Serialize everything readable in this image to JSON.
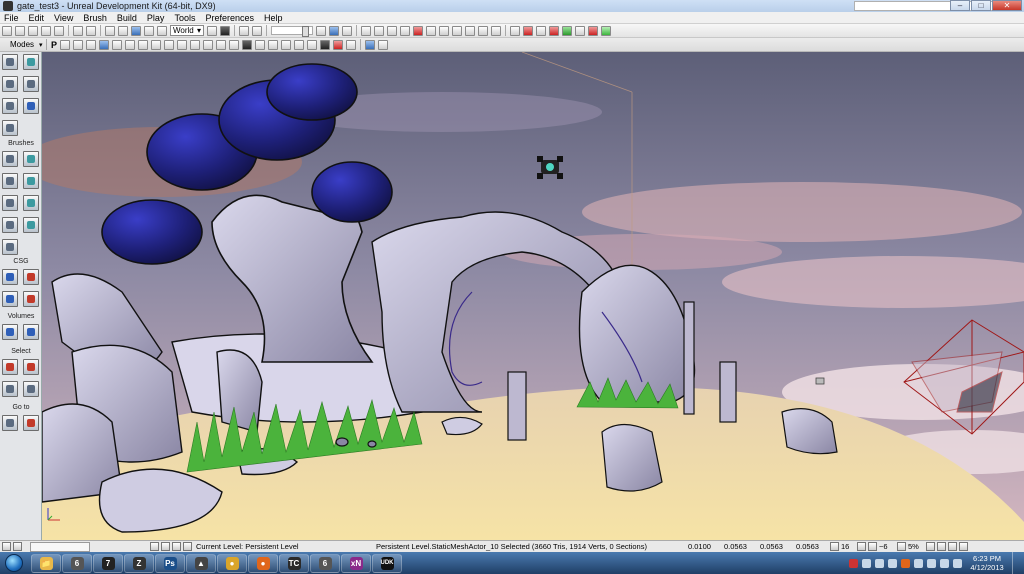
{
  "window": {
    "title": "gate_test3 - Unreal Development Kit (64-bit, DX9)",
    "minimize_glyph": "–",
    "maximize_glyph": "□",
    "close_glyph": "✕"
  },
  "menu": [
    "File",
    "Edit",
    "View",
    "Brush",
    "Build",
    "Play",
    "Tools",
    "Preferences",
    "Help"
  ],
  "toolbar": {
    "coordinate_system": "World",
    "coordinate_system_arrow": "▾"
  },
  "modes_panel": {
    "header": "Modes",
    "sections": {
      "brushes": "Brushes",
      "csg": "CSG",
      "volumes": "Volumes",
      "select": "Select",
      "goto": "Go to"
    }
  },
  "viewport_toolbar": {
    "perspective_label": "P"
  },
  "status_bar": {
    "current_level": "Current Level: Persistent Level",
    "selection": "Persistent Level.StaticMeshActor_10 Selected (3660 Tris, 1914 Verts, 0 Sections)",
    "drag_grid_values": [
      "0.0100",
      "0.0563",
      "0.0563",
      "0.0563"
    ],
    "grid_size": "16",
    "rotation_snap": "~6",
    "scale_snap": "5%"
  },
  "taskbar": {
    "apps": [
      {
        "name": "windows-explorer",
        "glyph": "📁",
        "color": "#e8b84a"
      },
      {
        "name": "app-6",
        "glyph": "6",
        "color": "#555555"
      },
      {
        "name": "app-7",
        "glyph": "7",
        "color": "#222222"
      },
      {
        "name": "zbrush",
        "glyph": "Z",
        "color": "#333333"
      },
      {
        "name": "photoshop",
        "glyph": "Ps",
        "color": "#1b4f8a"
      },
      {
        "name": "app-car",
        "glyph": "▲",
        "color": "#444444"
      },
      {
        "name": "chrome",
        "glyph": "●",
        "color": "#d9a52a"
      },
      {
        "name": "firefox",
        "glyph": "●",
        "color": "#e0661b"
      },
      {
        "name": "app-tc",
        "glyph": "TC",
        "color": "#2a2a2a"
      },
      {
        "name": "app-6b",
        "glyph": "6",
        "color": "#555555"
      },
      {
        "name": "xnormal",
        "glyph": "xN",
        "color": "#8a2a8a"
      },
      {
        "name": "udk",
        "glyph": "UDK",
        "color": "#111111"
      }
    ],
    "clock_time": "6:23 PM",
    "clock_date": "4/12/2013"
  },
  "colors": {
    "sky_top": "#5d5f78",
    "sky_bottom": "#c9a7b4",
    "sand": "#f1dca6",
    "rock": "#c7c3d8",
    "canopy": "#22237a",
    "grass": "#4bb33c"
  }
}
